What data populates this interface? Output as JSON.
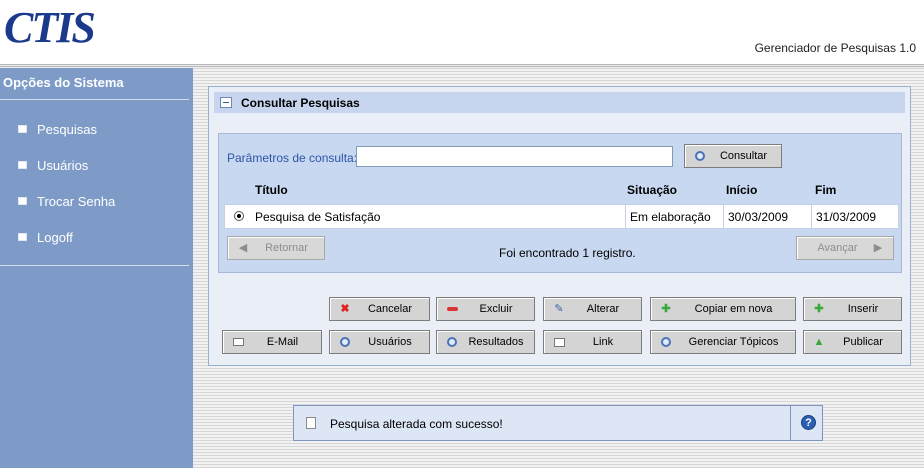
{
  "header": {
    "logo_text": "CTIS",
    "app_title": "Gerenciador de Pesquisas 1.0"
  },
  "sidebar": {
    "title": "Opções do Sistema",
    "items": [
      {
        "label": "Pesquisas",
        "icon": "bullet-icon"
      },
      {
        "label": "Usuários",
        "icon": "bullet-icon"
      },
      {
        "label": "Trocar Senha",
        "icon": "bullet-icon"
      },
      {
        "label": "Logoff",
        "icon": "bullet-icon"
      }
    ]
  },
  "panel": {
    "title": "Consultar Pesquisas",
    "params_label": "Parâmetros de consulta:",
    "params_value": "",
    "search_button": "Consultar",
    "columns": [
      "Título",
      "Situação",
      "Início",
      "Fim"
    ],
    "rows": [
      {
        "titulo": "Pesquisa de Satisfação",
        "situacao": "Em elaboração",
        "inicio": "30/03/2009",
        "fim": "31/03/2009",
        "selected": true
      }
    ],
    "back_button": "Retornar",
    "next_button": "Avançar",
    "result_text": "Foi encontrado 1 registro."
  },
  "actions": {
    "cancel": "Cancelar",
    "delete": "Excluir",
    "edit": "Alterar",
    "copy": "Copiar em nova",
    "insert": "Inserir",
    "email": "E-Mail",
    "users": "Usuários",
    "results": "Resultados",
    "link": "Link",
    "topics": "Gerenciar Tópicos",
    "publish": "Publicar"
  },
  "message": {
    "text": "Pesquisa alterada com sucesso!",
    "help": "?"
  },
  "colors": {
    "sidebar": "#7e9bc8",
    "panel_head": "#c7d6ee",
    "label_blue": "#2d55a8",
    "logo": "#1b3a8c"
  }
}
